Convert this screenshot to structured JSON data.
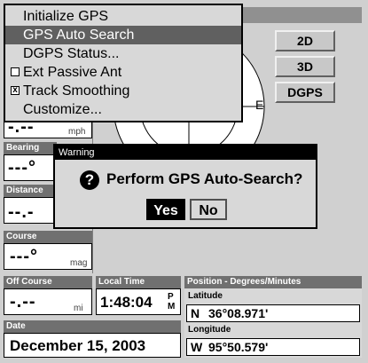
{
  "menu": {
    "items": [
      {
        "label": "Initialize GPS",
        "checkbox": false,
        "checked": false,
        "selected": false
      },
      {
        "label": "GPS Auto Search",
        "checkbox": false,
        "checked": false,
        "selected": true
      },
      {
        "label": "DGPS Status...",
        "checkbox": false,
        "checked": false,
        "selected": false
      },
      {
        "label": "Ext Passive Ant",
        "checkbox": true,
        "checked": false,
        "selected": false
      },
      {
        "label": "Track Smoothing",
        "checkbox": true,
        "checked": true,
        "selected": false
      },
      {
        "label": "Customize...",
        "checkbox": false,
        "checked": false,
        "selected": false
      }
    ],
    "check_mark": "x"
  },
  "gps_buttons": {
    "mode_2d": "2D",
    "mode_3d": "3D",
    "dgps": "DGPS"
  },
  "sky_plot": {
    "east_label": "E"
  },
  "fields": {
    "speed": {
      "value": "-.--",
      "unit": "mph"
    },
    "bearing": {
      "label": "Bearing",
      "value": "---°"
    },
    "distance": {
      "label": "Distance",
      "value": "--.-"
    },
    "course": {
      "label": "Course",
      "value": "---°",
      "unit": "mag"
    },
    "off_course": {
      "label": "Off Course",
      "value": "-.--",
      "unit": "mi"
    },
    "local_time": {
      "label": "Local Time",
      "value": "1:48:04",
      "ampm_top": "P",
      "ampm_bottom": "M"
    },
    "date": {
      "label": "Date",
      "value": "December 15, 2003"
    }
  },
  "position": {
    "header": "Position - Degrees/Minutes",
    "latitude_label": "Latitude",
    "latitude_hemi": "N",
    "latitude_value": "36°08.971'",
    "longitude_label": "Longitude",
    "longitude_hemi": "W",
    "longitude_value": "95°50.579'"
  },
  "dialog": {
    "title": "Warning",
    "icon": "question-icon",
    "icon_glyph": "?",
    "message": "Perform GPS Auto-Search?",
    "yes_label": "Yes",
    "no_label": "No"
  },
  "colors": {
    "screen_bg": "#d0d0d0",
    "label_bg": "#707070",
    "selection": "#606060"
  }
}
